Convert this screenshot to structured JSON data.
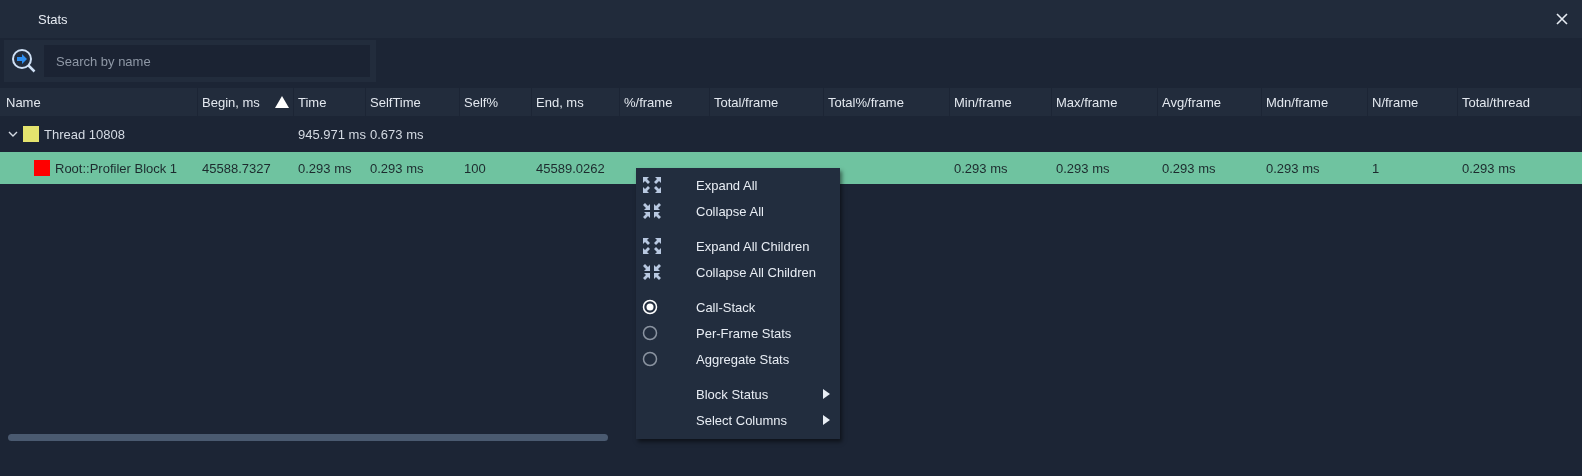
{
  "window": {
    "title": "Stats"
  },
  "search": {
    "placeholder": "Search by name"
  },
  "table": {
    "columns": [
      {
        "label": "Name",
        "sorted": false
      },
      {
        "label": "Begin, ms",
        "sorted": true
      },
      {
        "label": "Time",
        "sorted": false
      },
      {
        "label": "SelfTime",
        "sorted": false
      },
      {
        "label": "Self%",
        "sorted": false
      },
      {
        "label": "End, ms",
        "sorted": false
      },
      {
        "label": "%/frame",
        "sorted": false
      },
      {
        "label": "Total/frame",
        "sorted": false
      },
      {
        "label": "Total%/frame",
        "sorted": false
      },
      {
        "label": "Min/frame",
        "sorted": false
      },
      {
        "label": "Max/frame",
        "sorted": false
      },
      {
        "label": "Avg/frame",
        "sorted": false
      },
      {
        "label": "Mdn/frame",
        "sorted": false
      },
      {
        "label": "N/frame",
        "sorted": false
      },
      {
        "label": "Total/thread",
        "sorted": false
      }
    ],
    "rows": [
      {
        "expanded": true,
        "color": "#e4e46e",
        "selected": false,
        "cells": [
          "Thread 10808",
          "",
          "945.971 ms",
          "0.673 ms",
          "",
          "",
          "",
          "",
          "",
          "",
          "",
          "",
          "",
          "",
          ""
        ],
        "children": [
          {
            "color": "#ff0000",
            "selected": true,
            "cells": [
              "Root::Profiler Block 1",
              "45588.7327",
              "0.293 ms",
              "0.293 ms",
              "100",
              "45589.0262",
              "",
              "",
              "",
              "0.293 ms",
              "0.293 ms",
              "0.293 ms",
              "0.293 ms",
              "1",
              "0.293 ms"
            ]
          }
        ]
      }
    ]
  },
  "context_menu": {
    "groups": [
      [
        {
          "kind": "expand",
          "label": "Expand All"
        },
        {
          "kind": "collapse",
          "label": "Collapse All"
        }
      ],
      [
        {
          "kind": "expand",
          "label": "Expand All Children"
        },
        {
          "kind": "collapse",
          "label": "Collapse All Children"
        }
      ],
      [
        {
          "kind": "radio",
          "label": "Call-Stack",
          "selected": true
        },
        {
          "kind": "radio",
          "label": "Per-Frame Stats",
          "selected": false
        },
        {
          "kind": "radio",
          "label": "Aggregate Stats",
          "selected": false
        }
      ],
      [
        {
          "kind": "submenu",
          "label": "Block Status"
        },
        {
          "kind": "submenu",
          "label": "Select Columns"
        }
      ]
    ]
  }
}
